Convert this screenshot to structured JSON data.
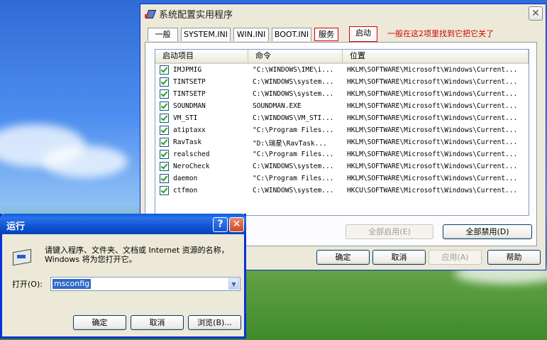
{
  "msconfig": {
    "title": "系统配置实用程序",
    "close_glyph": "✕",
    "tabs": [
      "一般",
      "SYSTEM.INI",
      "WIN.INI",
      "BOOT.INI",
      "服务",
      "启动"
    ],
    "annotation": "一般在这2项里找到它把它关了",
    "columns": [
      "启动项目",
      "命令",
      "位置"
    ],
    "rows": [
      {
        "name": "IMJPMIG",
        "command": "\"C:\\WINDOWS\\IME\\i...",
        "location": "HKLM\\SOFTWARE\\Microsoft\\Windows\\Current...",
        "checked": true
      },
      {
        "name": "TINTSETP",
        "command": "C:\\WINDOWS\\system...",
        "location": "HKLM\\SOFTWARE\\Microsoft\\Windows\\Current...",
        "checked": true
      },
      {
        "name": "TINTSETP",
        "command": "C:\\WINDOWS\\system...",
        "location": "HKLM\\SOFTWARE\\Microsoft\\Windows\\Current...",
        "checked": true
      },
      {
        "name": "SOUNDMAN",
        "command": "SOUNDMAN.EXE",
        "location": "HKLM\\SOFTWARE\\Microsoft\\Windows\\Current...",
        "checked": true
      },
      {
        "name": "VM_STI",
        "command": "C:\\WINDOWS\\VM_STI...",
        "location": "HKLM\\SOFTWARE\\Microsoft\\Windows\\Current...",
        "checked": true
      },
      {
        "name": "atiptaxx",
        "command": "\"C:\\Program Files...",
        "location": "HKLM\\SOFTWARE\\Microsoft\\Windows\\Current...",
        "checked": true
      },
      {
        "name": "RavTask",
        "command": "\"D:\\瑞星\\RavTask...",
        "location": "HKLM\\SOFTWARE\\Microsoft\\Windows\\Current...",
        "checked": true
      },
      {
        "name": "realsched",
        "command": "\"C:\\Program Files...",
        "location": "HKLM\\SOFTWARE\\Microsoft\\Windows\\Current...",
        "checked": true
      },
      {
        "name": "NeroCheck",
        "command": "C:\\WINDOWS\\system...",
        "location": "HKLM\\SOFTWARE\\Microsoft\\Windows\\Current...",
        "checked": true
      },
      {
        "name": "daemon",
        "command": "\"C:\\Program Files...",
        "location": "HKLM\\SOFTWARE\\Microsoft\\Windows\\Current...",
        "checked": true
      },
      {
        "name": "ctfmon",
        "command": "C:\\WINDOWS\\system...",
        "location": "HKCU\\SOFTWARE\\Microsoft\\Windows\\Current...",
        "checked": true
      }
    ],
    "enable_all": "全部启用(E)",
    "disable_all": "全部禁用(D)",
    "ok": "确定",
    "cancel": "取消",
    "apply": "应用(A)",
    "help": "帮助"
  },
  "run": {
    "title": "运行",
    "help_glyph": "?",
    "close_glyph": "✕",
    "description": "请键入程序、文件夹、文档或 Internet 资源的名称，Windows 将为您打开它。",
    "open_label": "打开(O):",
    "open_value": "msconfig",
    "dropdown_glyph": "▼",
    "ok": "确定",
    "cancel": "取消",
    "browse": "浏览(B)..."
  },
  "colors": {
    "xp_blue": "#0831d9",
    "annotation_red": "#d00000",
    "selection": "#316ac5"
  }
}
